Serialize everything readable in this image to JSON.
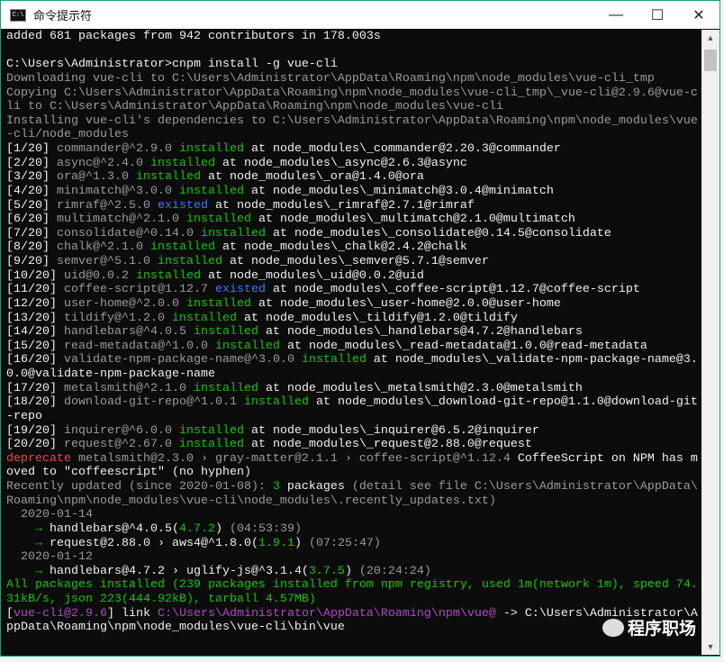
{
  "window": {
    "title": "命令提示符",
    "minimize": "—",
    "maximize": "☐",
    "close": "✕",
    "app_icon": "C:\\"
  },
  "watermark": "程序职场",
  "colors": {
    "w": "#f0f0f0",
    "d": "#9a9a9a",
    "g": "#16c60c",
    "b": "#3b78ff",
    "r": "#e74856",
    "p": "#b148c6"
  },
  "lines": [
    [
      [
        "w",
        "added 681 packages from 942 contributors in 178.003s"
      ]
    ],
    [],
    [
      [
        "w",
        "C:\\Users\\Administrator>cnpm install -g vue-cli"
      ]
    ],
    [
      [
        "d",
        "Downloading vue-cli to C:\\Users\\Administrator\\AppData\\Roaming\\npm\\node_modules\\vue-cli_tmp"
      ]
    ],
    [
      [
        "d",
        "Copying C:\\Users\\Administrator\\AppData\\Roaming\\npm\\node_modules\\vue-cli_tmp\\_vue-cli@2.9.6@vue-c"
      ]
    ],
    [
      [
        "d",
        "li to C:\\Users\\Administrator\\AppData\\Roaming\\npm\\node_modules\\vue-cli"
      ]
    ],
    [
      [
        "d",
        "Installing vue-cli's dependencies to C:\\Users\\Administrator\\AppData\\Roaming\\npm\\node_modules\\vue"
      ]
    ],
    [
      [
        "d",
        "-cli/node_modules"
      ]
    ],
    [
      [
        "w",
        "[1/20] "
      ],
      [
        "d",
        "commander@^2.9.0 "
      ],
      [
        "g",
        "installed"
      ],
      [
        "w",
        " at node_modules\\_commander@2.20.3@commander"
      ]
    ],
    [
      [
        "w",
        "[2/20] "
      ],
      [
        "d",
        "async@^2.4.0 "
      ],
      [
        "g",
        "installed"
      ],
      [
        "w",
        " at node_modules\\_async@2.6.3@async"
      ]
    ],
    [
      [
        "w",
        "[3/20] "
      ],
      [
        "d",
        "ora@^1.3.0 "
      ],
      [
        "g",
        "installed"
      ],
      [
        "w",
        " at node_modules\\_ora@1.4.0@ora"
      ]
    ],
    [
      [
        "w",
        "[4/20] "
      ],
      [
        "d",
        "minimatch@^3.0.0 "
      ],
      [
        "g",
        "installed"
      ],
      [
        "w",
        " at node_modules\\_minimatch@3.0.4@minimatch"
      ]
    ],
    [
      [
        "w",
        "[5/20] "
      ],
      [
        "d",
        "rimraf@^2.5.0 "
      ],
      [
        "b",
        "existed"
      ],
      [
        "w",
        " at node_modules\\_rimraf@2.7.1@rimraf"
      ]
    ],
    [
      [
        "w",
        "[6/20] "
      ],
      [
        "d",
        "multimatch@^2.1.0 "
      ],
      [
        "g",
        "installed"
      ],
      [
        "w",
        " at node_modules\\_multimatch@2.1.0@multimatch"
      ]
    ],
    [
      [
        "w",
        "[7/20] "
      ],
      [
        "d",
        "consolidate@^0.14.0 "
      ],
      [
        "g",
        "installed"
      ],
      [
        "w",
        " at node_modules\\_consolidate@0.14.5@consolidate"
      ]
    ],
    [
      [
        "w",
        "[8/20] "
      ],
      [
        "d",
        "chalk@^2.1.0 "
      ],
      [
        "g",
        "installed"
      ],
      [
        "w",
        " at node_modules\\_chalk@2.4.2@chalk"
      ]
    ],
    [
      [
        "w",
        "[9/20] "
      ],
      [
        "d",
        "semver@^5.1.0 "
      ],
      [
        "g",
        "installed"
      ],
      [
        "w",
        " at node_modules\\_semver@5.7.1@semver"
      ]
    ],
    [
      [
        "w",
        "[10/20] "
      ],
      [
        "d",
        "uid@0.0.2 "
      ],
      [
        "g",
        "installed"
      ],
      [
        "w",
        " at node_modules\\_uid@0.0.2@uid"
      ]
    ],
    [
      [
        "w",
        "[11/20] "
      ],
      [
        "d",
        "coffee-script@1.12.7 "
      ],
      [
        "b",
        "existed"
      ],
      [
        "w",
        " at node_modules\\_coffee-script@1.12.7@coffee-script"
      ]
    ],
    [
      [
        "w",
        "[12/20] "
      ],
      [
        "d",
        "user-home@^2.0.0 "
      ],
      [
        "g",
        "installed"
      ],
      [
        "w",
        " at node_modules\\_user-home@2.0.0@user-home"
      ]
    ],
    [
      [
        "w",
        "[13/20] "
      ],
      [
        "d",
        "tildify@^1.2.0 "
      ],
      [
        "g",
        "installed"
      ],
      [
        "w",
        " at node_modules\\_tildify@1.2.0@tildify"
      ]
    ],
    [
      [
        "w",
        "[14/20] "
      ],
      [
        "d",
        "handlebars@^4.0.5 "
      ],
      [
        "g",
        "installed"
      ],
      [
        "w",
        " at node_modules\\_handlebars@4.7.2@handlebars"
      ]
    ],
    [
      [
        "w",
        "[15/20] "
      ],
      [
        "d",
        "read-metadata@^1.0.0 "
      ],
      [
        "g",
        "installed"
      ],
      [
        "w",
        " at node_modules\\_read-metadata@1.0.0@read-metadata"
      ]
    ],
    [
      [
        "w",
        "[16/20] "
      ],
      [
        "d",
        "validate-npm-package-name@^3.0.0 "
      ],
      [
        "g",
        "installed"
      ],
      [
        "w",
        " at node_modules\\_validate-npm-package-name@3."
      ]
    ],
    [
      [
        "w",
        "0.0@validate-npm-package-name"
      ]
    ],
    [
      [
        "w",
        "[17/20] "
      ],
      [
        "d",
        "metalsmith@^2.1.0 "
      ],
      [
        "g",
        "installed"
      ],
      [
        "w",
        " at node_modules\\_metalsmith@2.3.0@metalsmith"
      ]
    ],
    [
      [
        "w",
        "[18/20] "
      ],
      [
        "d",
        "download-git-repo@^1.0.1 "
      ],
      [
        "g",
        "installed"
      ],
      [
        "w",
        " at node_modules\\_download-git-repo@1.1.0@download-git"
      ]
    ],
    [
      [
        "w",
        "-repo"
      ]
    ],
    [
      [
        "w",
        "[19/20] "
      ],
      [
        "d",
        "inquirer@^6.0.0 "
      ],
      [
        "g",
        "installed"
      ],
      [
        "w",
        " at node_modules\\_inquirer@6.5.2@inquirer"
      ]
    ],
    [
      [
        "w",
        "[20/20] "
      ],
      [
        "d",
        "request@^2.67.0 "
      ],
      [
        "g",
        "installed"
      ],
      [
        "w",
        " at node_modules\\_request@2.88.0@request"
      ]
    ],
    [
      [
        "r",
        "deprecate"
      ],
      [
        "d",
        " metalsmith@2.3.0 › gray-matter@2.1.1 › coffee-script@^1.12.4"
      ],
      [
        "w",
        " CoffeeScript on NPM has m"
      ]
    ],
    [
      [
        "w",
        "oved to \"coffeescript\" (no hyphen)"
      ]
    ],
    [
      [
        "d",
        "Recently updated (since 2020-01-08): "
      ],
      [
        "g",
        "3"
      ],
      [
        "w",
        " packages"
      ],
      [
        "d",
        " (detail see file C:\\Users\\Administrator\\AppData\\"
      ]
    ],
    [
      [
        "d",
        "Roaming\\npm\\node_modules\\vue-cli\\node_modules\\.recently_updates.txt)"
      ]
    ],
    [
      [
        "d",
        "  2020-01-14"
      ]
    ],
    [
      [
        "g",
        "    → "
      ],
      [
        "w",
        "handlebars@^4.0.5("
      ],
      [
        "g",
        "4.7.2"
      ],
      [
        "w",
        ")"
      ],
      [
        "d",
        " (04:53:39)"
      ]
    ],
    [
      [
        "g",
        "    → "
      ],
      [
        "w",
        "request@2.88.0 › aws4@^1.8.0("
      ],
      [
        "g",
        "1.9.1"
      ],
      [
        "w",
        ")"
      ],
      [
        "d",
        " (07:25:47)"
      ]
    ],
    [
      [
        "d",
        "  2020-01-12"
      ]
    ],
    [
      [
        "g",
        "    → "
      ],
      [
        "w",
        "handlebars@4.7.2 › uglify-js@^3.1.4("
      ],
      [
        "g",
        "3.7.5"
      ],
      [
        "w",
        ")"
      ],
      [
        "d",
        " (20:24:24)"
      ]
    ],
    [
      [
        "g",
        "All packages installed (239 packages installed from npm registry, used 1m(network 1m), speed 74."
      ]
    ],
    [
      [
        "g",
        "31kB/s, json 223(444.92kB), tarball 4.57MB)"
      ]
    ],
    [
      [
        "w",
        "["
      ],
      [
        "p",
        "vue-cli@2.9.6"
      ],
      [
        "w",
        "] link "
      ],
      [
        "p",
        "C:\\Users\\Administrator\\AppData\\Roaming\\npm\\vue@"
      ],
      [
        "w",
        " -> C:\\Users\\Administrator\\A"
      ]
    ],
    [
      [
        "w",
        "ppData\\Roaming\\npm\\node_modules\\vue-cli\\bin\\vue"
      ]
    ]
  ]
}
